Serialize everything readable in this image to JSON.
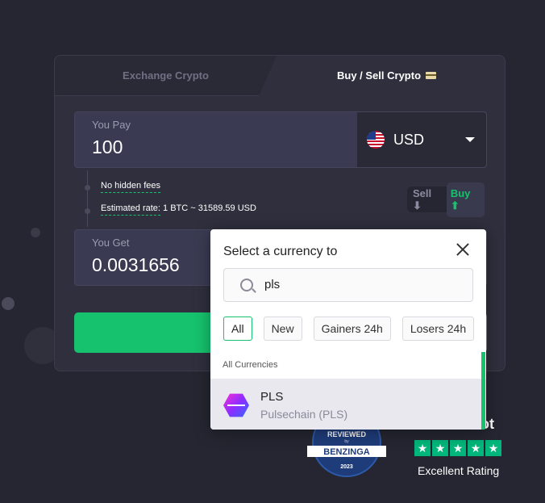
{
  "tabs": {
    "exchange": "Exchange Crypto",
    "buy_sell": "Buy / Sell Crypto"
  },
  "pay": {
    "label": "You Pay",
    "value": "100",
    "currency": "USD"
  },
  "info": {
    "fees": "No hidden fees",
    "rate_label": "Estimated rate:",
    "rate_value": "1 BTC ~ 31589.59 USD"
  },
  "toggle": {
    "sell": "Sell",
    "buy": "Buy"
  },
  "get": {
    "label": "You Get",
    "value": "0.0031656"
  },
  "badge": {
    "reviewed": "REVIEWED",
    "by": "by",
    "name": "BENZINGA",
    "year": "2023"
  },
  "trustpilot": {
    "title_fragment": "ot",
    "rating": "Excellent Rating",
    "stars": 5
  },
  "modal": {
    "title": "Select a currency to",
    "search_value": "pls",
    "filters": [
      "All",
      "New",
      "Gainers 24h",
      "Losers 24h"
    ],
    "active_filter": "All",
    "section": "All Currencies",
    "items": [
      {
        "symbol": "PLS",
        "name": "Pulsechain (PLS)"
      }
    ]
  },
  "colors": {
    "accent": "#16c26e",
    "background": "#262632",
    "card": "#2f2f3d"
  }
}
